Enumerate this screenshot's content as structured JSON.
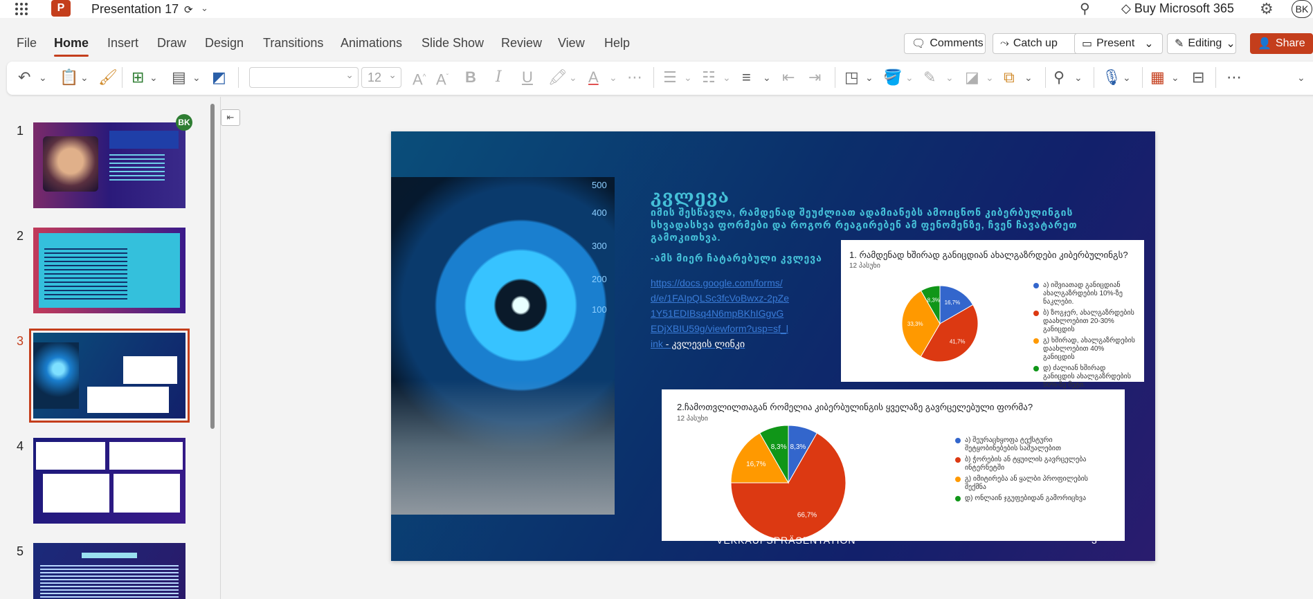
{
  "app": {
    "doc_title": "Presentation 17",
    "buy_label": "Buy Microsoft 365",
    "avatar": "BK"
  },
  "menu": {
    "tabs": [
      "File",
      "Home",
      "Insert",
      "Draw",
      "Design",
      "Transitions",
      "Animations",
      "Slide Show",
      "Review",
      "View",
      "Help"
    ],
    "active": "Home"
  },
  "actions": {
    "comments": "Comments",
    "catchup": "Catch up",
    "present": "Present",
    "editing": "Editing",
    "share": "Share"
  },
  "ribbon": {
    "font_size": "12"
  },
  "thumbnails": {
    "numbers": [
      "1",
      "2",
      "3",
      "4",
      "5"
    ],
    "selected": "3",
    "badge": "BK"
  },
  "slide": {
    "title": "კვლევა",
    "subtitle": "იმის შესწავლა, რამდენად შეუძლიათ ადამიანებს ამოიცნონ კიბერბულინგის სხვადასხვა ფორმები და როგორ რეაგირებენ ამ ფენომენზე, ჩვენ ჩავატარეთ გამოკითხვა.",
    "survey_label": "-ამს მიერ ჩატარებული კვლევა",
    "link": "https://docs.google.com/forms/d/e/1FAIpQLSc3fcVoBwxz-2pZe1Y51EDIBsq4N6mpBKhIGgvGEDjXBIU59g/viewform?usp=sf_link",
    "link_tail": " - კვლევის ლინკი",
    "footer": "VEKKAUFSPRÄSENTATION",
    "page": "3"
  },
  "chart_data": [
    {
      "type": "pie",
      "title": "1. რამდენად ხშირად განიცდიან ახალგაზრდები კიბერბულინგს?",
      "subtitle": "12 პასუხი",
      "labels": [
        "ა) იშვიათად განიცდიან ახალგაზრდების 10%-ზე ნაკლები.",
        "ბ) ზოგჯერ, ახალგაზრდების დაახლოებით 20-30% განიცდის",
        "გ) ხშირად, ახალგაზრდების დაახლოებით 40% განიცდის",
        "დ) ძალიან ხშირად განიცდის ახალგაზრდების 50%-ზე მეტი."
      ],
      "values": [
        16.7,
        41.7,
        33.3,
        8.3
      ],
      "value_labels": [
        "16,7%",
        "41,7%",
        "33,3%",
        "8,3%"
      ],
      "colors": [
        "#3366cc",
        "#dc3912",
        "#ff9900",
        "#109618"
      ]
    },
    {
      "type": "pie",
      "title": "2.ჩამოთვლილთაგან რომელია კიბერბულინგის ყველაზე გავრცელებული ფორმა?",
      "subtitle": "12 პასუხი",
      "labels": [
        "ა) შეურაცხყოფა ტექსტური შეტყობინებების საშუალებით",
        "ბ) ჭორების ან ტყუილის გავრცელება ინტერნეტში",
        "გ) იმიტირება ან ყალბი პროფილების შექმნა",
        "დ) ონლაინ ჯგუფებიდან გამორიცხვა"
      ],
      "values": [
        8.3,
        66.7,
        16.7,
        8.3
      ],
      "value_labels": [
        "8,3%",
        "66,7%",
        "16,7%",
        "8,3%"
      ],
      "colors": [
        "#3366cc",
        "#dc3912",
        "#ff9900",
        "#109618"
      ]
    }
  ]
}
